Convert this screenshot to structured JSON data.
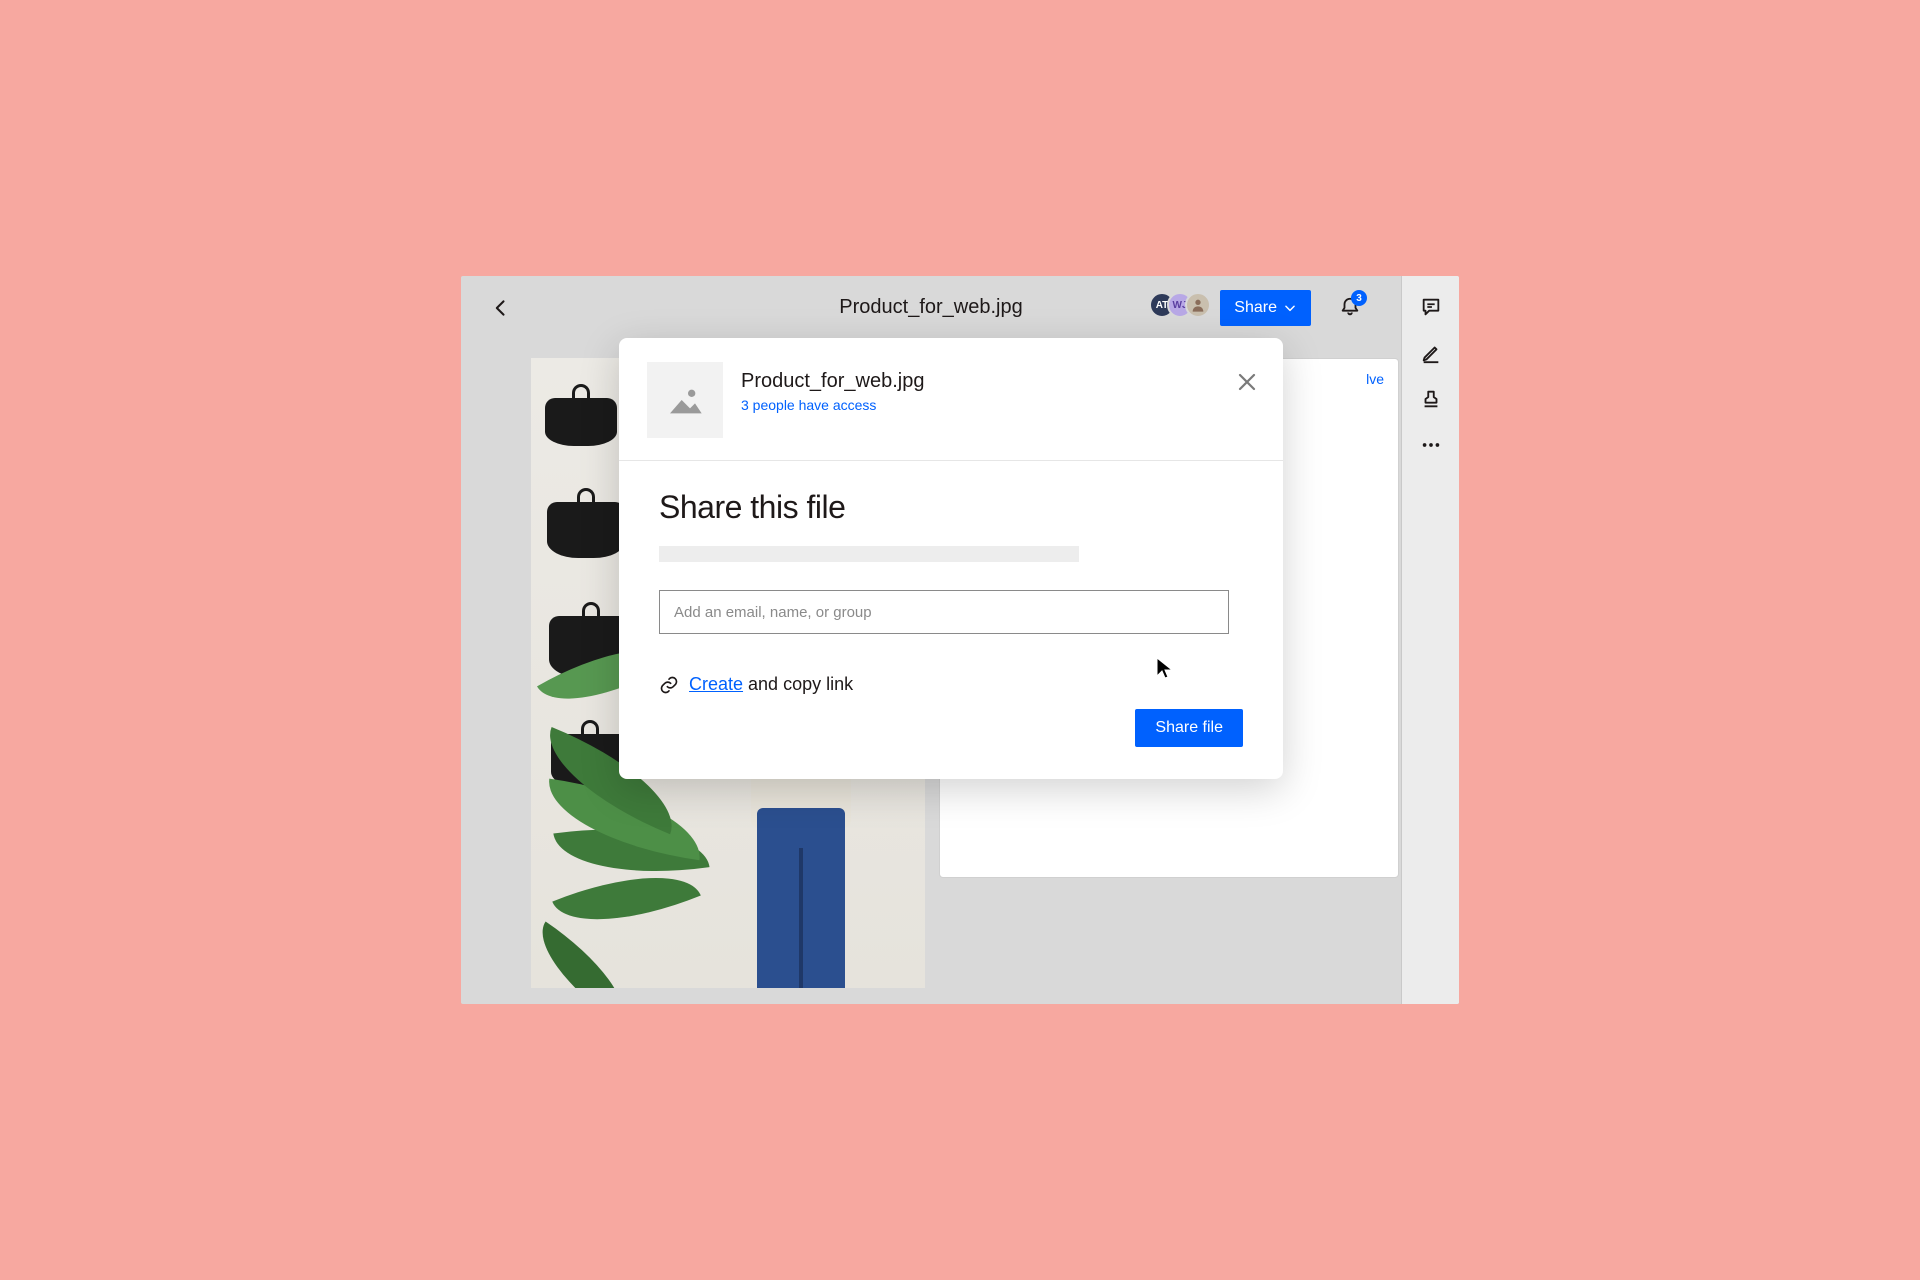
{
  "page": {
    "filename": "Product_for_web.jpg"
  },
  "topbar": {
    "share_label": "Share",
    "notification_count": "3",
    "avatars": [
      {
        "initials": "AT"
      },
      {
        "initials": "WJ"
      },
      {
        "initials": ""
      }
    ]
  },
  "comment_panel": {
    "resolve_label": "lve"
  },
  "modal": {
    "filename": "Product_for_web.jpg",
    "access_text": "3 people have access",
    "title": "Share this file",
    "input_placeholder": "Add an email, name, or group",
    "create_label": "Create",
    "copy_suffix": " and copy link",
    "share_button": "Share file"
  },
  "colors": {
    "accent": "#0061fe",
    "page_bg": "#f7a8a0"
  }
}
